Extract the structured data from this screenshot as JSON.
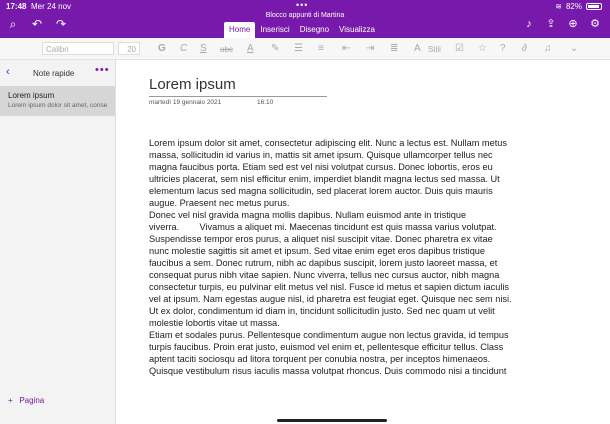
{
  "status": {
    "time": "17:48",
    "date": "Mer 24 nov",
    "battery": "82%"
  },
  "window_title": "Blocco appunti di Martina",
  "tabs": [
    "Home",
    "Inserisci",
    "Disegno",
    "Visualizza"
  ],
  "ribbon": {
    "font_name": "Calibri",
    "font_size": "20",
    "styles_label": "Stili"
  },
  "sidebar": {
    "title": "Note rapide",
    "item_title": "Lorem ipsum",
    "item_snippet": "Lorem ipsum dolor sit amet, consectetur",
    "add_page": "Pagina"
  },
  "page": {
    "title": "Lorem ipsum",
    "date": "martedì 19 gennaio 2021",
    "time": "16:10",
    "lines": [
      "Lorem ipsum dolor sit amet, consectetur adipiscing elit. Nunc a lectus est. Nullam metus",
      "massa, sollicitudin id varius in, mattis sit amet ipsum. Quisque ullamcorper tellus nec",
      "magna faucibus porta. Etiam sed est vel nisi volutpat cursus. Donec lobortis, eros eu",
      "ultricies placerat, sem nisl efficitur enim, imperdiet blandit magna lectus sed massa. Ut",
      "elementum lacus sed magna sollicitudin, sed placerat lorem auctor. Duis quis mauris",
      "augue. Praesent nec metus purus.",
      "Donec vel nisl gravida magna mollis dapibus. Nullam euismod ante in tristique",
      "viverra.        Vivamus a aliquet mi. Maecenas tincidunt est quis massa varius volutpat.",
      "Suspendisse tempor eros purus, a aliquet nisl suscipit vitae. Donec pharetra ex vitae",
      "nunc molestie sagittis sit amet et ipsum. Sed vitae enim eget eros dapibus tristique",
      "faucibus a sem. Donec rutrum, nibh ac dapibus suscipit, lorem justo laoreet massa, et",
      "consequat purus nibh vitae sapien. Nunc viverra, tellus nec cursus auctor, nibh magna",
      "consectetur turpis, eu pulvinar elit metus vel nisl. Fusce id metus et sapien dictum iaculis",
      "vel at ipsum. Nam egestas augue nisl, id pharetra est feugiat eget. Quisque nec sem nisi.",
      "Ut ex dolor, condimentum id diam in, tincidunt sollicitudin justo. Sed nec quam ut velit",
      "molestie lobortis vitae ut massa.",
      "Etiam et sodales purus. Pellentesque condimentum augue non lectus gravida, id tempus",
      "turpis faucibus. Proin erat justo, euismod vel enim et, pellentesque efficitur tellus. Class",
      "aptent taciti sociosqu ad litora torquent per conubia nostra, per inceptos himenaeos.",
      "Quisque vestibulum risus iaculis massa volutpat rhoncus. Duis commodo nisi a tincidunt"
    ]
  }
}
